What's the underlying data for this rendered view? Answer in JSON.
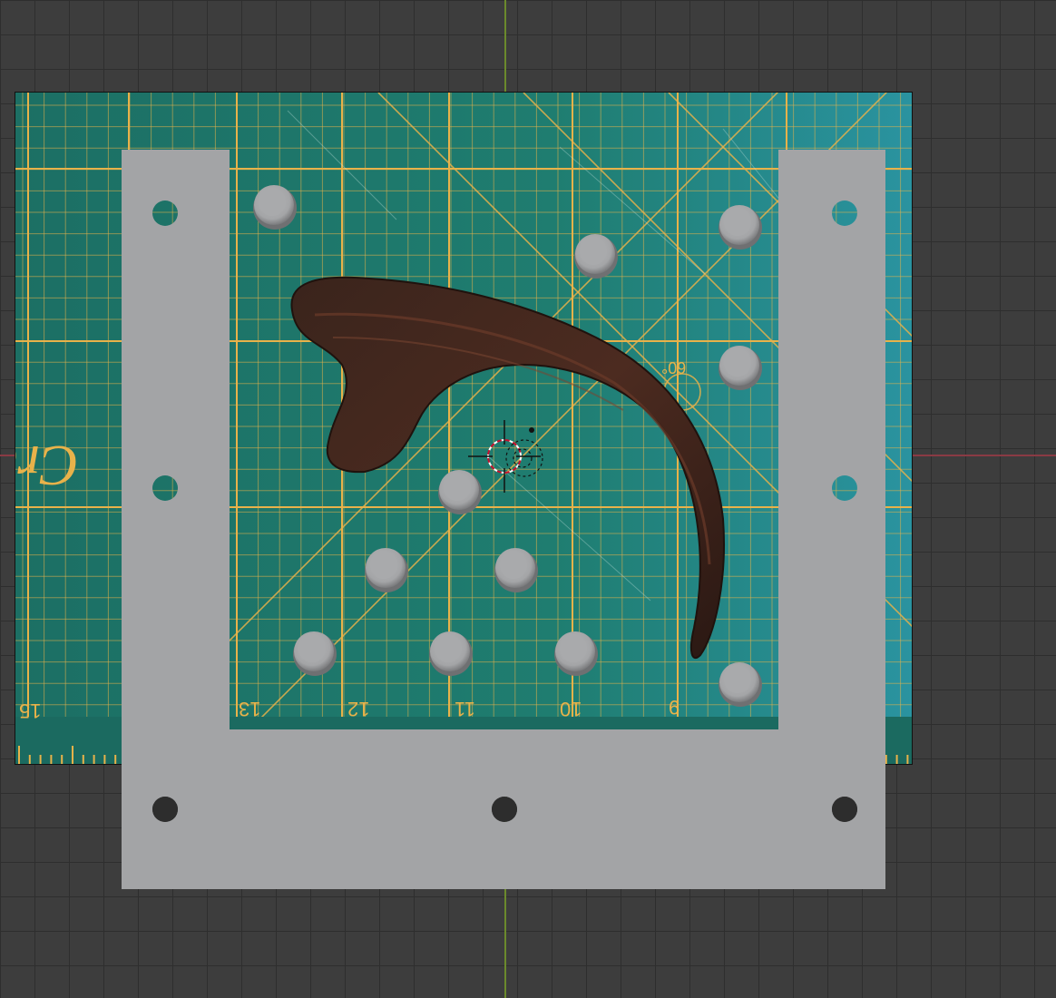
{
  "viewport": {
    "background_color": "#3d3d3d",
    "grid_color": "#2e2e2e",
    "y_axis_color": "#6b8a2c",
    "x_axis_color": "#8a3a44"
  },
  "reference_image": {
    "subject": "claw",
    "mat_color": "#1f7d70",
    "line_color": "#e8b24a",
    "ruler_numbers": [
      "15",
      "13",
      "12",
      "11",
      "10",
      "9"
    ],
    "angle_label": "60°"
  },
  "template_plate": {
    "color": "#a3a4a6",
    "stud_color": "#a6a7a9"
  },
  "scene_icons": [
    "3d-cursor-icon",
    "origin-icon"
  ]
}
